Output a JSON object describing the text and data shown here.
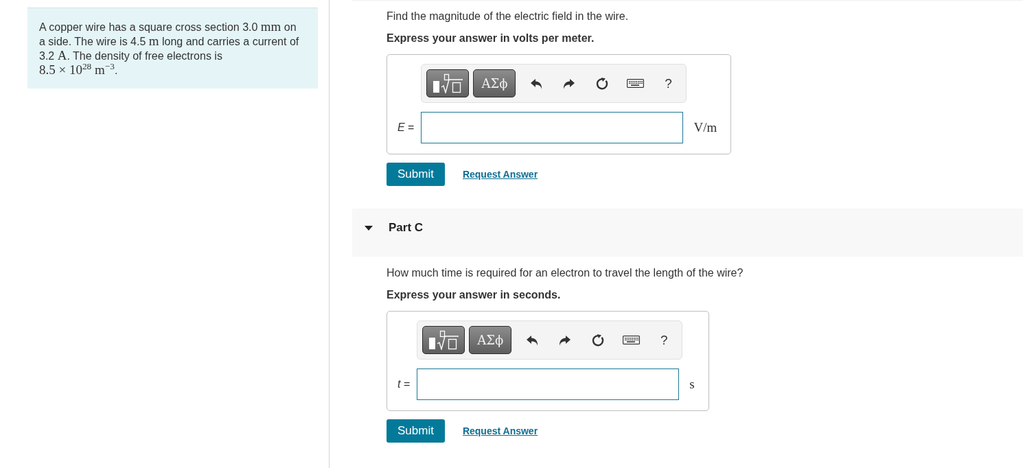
{
  "problem": {
    "statement": [
      {
        "kind": "text",
        "text": "A copper wire has a square cross section 3.0 "
      },
      {
        "kind": "math",
        "text": "mm"
      },
      {
        "kind": "text",
        "text": " on a side. The wire is 4.5 "
      },
      {
        "kind": "math",
        "text": "m"
      },
      {
        "kind": "text",
        "text": " long and carries a current of 3.2 "
      },
      {
        "kind": "math",
        "text": "A"
      },
      {
        "kind": "text",
        "text": ". The density of free electrons is "
      },
      {
        "kind": "math",
        "text": "8.5 × 10$^{28}$ m$^{−3}$"
      },
      {
        "kind": "text",
        "text": "."
      }
    ]
  },
  "parts": [
    {
      "question": "Find the magnitude of the electric field in the wire.",
      "instruction": "Express your answer in volts per meter.",
      "answer": {
        "toolbar": [
          {
            "kind": "templates"
          },
          {
            "kind": "symbols",
            "label": "ΑΣϕ"
          },
          {
            "kind": "undo"
          },
          {
            "kind": "redo"
          },
          {
            "kind": "reset"
          },
          {
            "kind": "keyboard"
          },
          {
            "kind": "help",
            "label": "?"
          }
        ],
        "label": "*E* =",
        "unit": "V/m"
      },
      "actions": {
        "submit": "Submit",
        "request": "Request Answer"
      }
    },
    {
      "header": {
        "title": "Part C",
        "expanded": true
      },
      "question": "How much time is required for an electron to travel the length of the wire?",
      "instruction": "Express your answer in seconds.",
      "answer": {
        "toolbar": [
          {
            "kind": "templates"
          },
          {
            "kind": "symbols",
            "label": "ΑΣϕ"
          },
          {
            "kind": "undo"
          },
          {
            "kind": "redo"
          },
          {
            "kind": "reset"
          },
          {
            "kind": "keyboard"
          },
          {
            "kind": "help",
            "label": "?"
          }
        ],
        "label": "*t* =",
        "unit": "s"
      },
      "actions": {
        "submit": "Submit",
        "request": "Request Answer"
      }
    }
  ]
}
